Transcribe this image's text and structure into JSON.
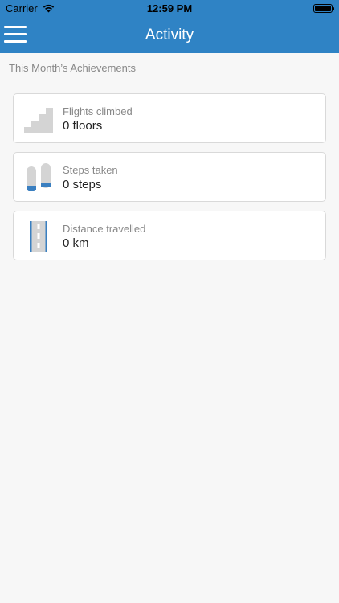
{
  "status_bar": {
    "carrier": "Carrier",
    "time": "12:59 PM"
  },
  "nav": {
    "title": "Activity"
  },
  "section_title": "This Month’s Achievements",
  "cards": [
    {
      "label": "Flights climbed",
      "value": "0 floors",
      "icon": "stairs-icon"
    },
    {
      "label": "Steps taken",
      "value": "0 steps",
      "icon": "footprints-icon"
    },
    {
      "label": "Distance travelled",
      "value": "0 km",
      "icon": "road-icon"
    }
  ],
  "colors": {
    "header": "#2f83c5",
    "background": "#f7f7f7",
    "accent_blue": "#3a7fc0"
  }
}
